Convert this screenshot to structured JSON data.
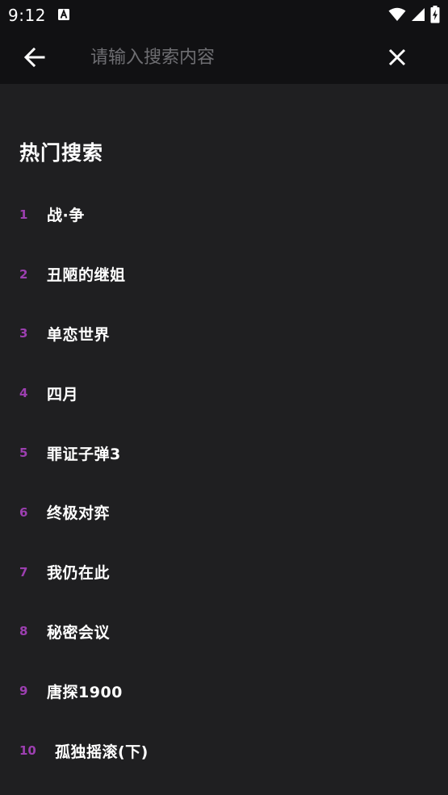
{
  "status_bar": {
    "time": "9:12",
    "icons": [
      "a-notification-icon",
      "wifi-icon",
      "signal-icon",
      "battery-charging-icon"
    ]
  },
  "search": {
    "placeholder": "请输入搜索内容",
    "value": "",
    "back_icon": "arrow-left-icon",
    "close_icon": "close-icon"
  },
  "hot_search": {
    "title": "热门搜索",
    "items": [
      {
        "rank": "1",
        "title": "战·争"
      },
      {
        "rank": "2",
        "title": "丑陋的继姐"
      },
      {
        "rank": "3",
        "title": "单恋世界"
      },
      {
        "rank": "4",
        "title": "四月"
      },
      {
        "rank": "5",
        "title": "罪证子弹3"
      },
      {
        "rank": "6",
        "title": "终极对弈"
      },
      {
        "rank": "7",
        "title": "我仍在此"
      },
      {
        "rank": "8",
        "title": "秘密会议"
      },
      {
        "rank": "9",
        "title": "唐探1900"
      },
      {
        "rank": "10",
        "title": "孤独摇滚(下)"
      }
    ]
  },
  "colors": {
    "background": "#1f1f21",
    "header": "#111113",
    "rank_accent": "#9c3fb0",
    "placeholder": "#6e6e72",
    "text": "#ffffff"
  }
}
